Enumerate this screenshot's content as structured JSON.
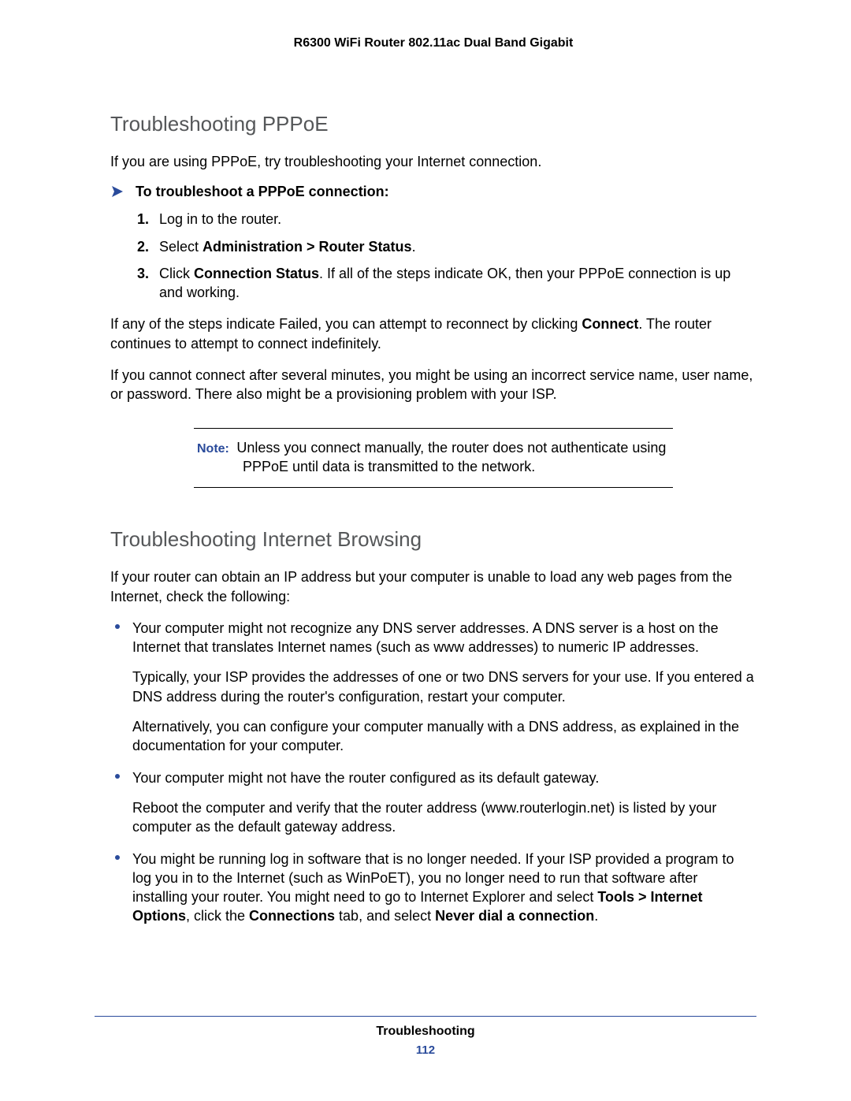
{
  "header": "R6300 WiFi Router 802.11ac Dual Band Gigabit",
  "section1": {
    "title": "Troubleshooting PPPoE",
    "intro": "If you are using PPPoE, try troubleshooting your Internet connection.",
    "proc_label": "To troubleshoot a PPPoE connection:",
    "step1": "Log in to the router.",
    "step2_pre": "Select ",
    "step2_bold": "Administration > Router Status",
    "step2_post": ".",
    "step3_pre": "Click ",
    "step3_bold": "Connection Status",
    "step3_post": ". If all of the steps indicate OK, then your PPPoE connection is up and working.",
    "para2_pre": "If any of the steps indicate Failed, you can attempt to reconnect by clicking ",
    "para2_bold": "Connect",
    "para2_post": ". The router continues to attempt to connect indefinitely.",
    "para3": "If you cannot connect after several minutes, you might be using an incorrect service name, user name, or password. There also might be a provisioning problem with your ISP.",
    "note_label": "Note:",
    "note_line1": "Unless you connect manually, the router does not authenticate using",
    "note_line2": "PPPoE until data is transmitted to the network."
  },
  "section2": {
    "title": "Troubleshooting Internet Browsing",
    "intro": "If your router can obtain an IP address but your computer is unable to load any web pages from the Internet, check the following:",
    "b1_p1": "Your computer might not recognize any DNS server addresses. A DNS server is a host on the Internet that translates Internet names (such as www addresses) to numeric IP addresses.",
    "b1_p2": "Typically, your ISP provides the addresses of one or two DNS servers for your use. If you entered a DNS address during the router's configuration, restart your computer.",
    "b1_p3": "Alternatively, you can configure your computer manually with a DNS address, as explained in the documentation for your computer.",
    "b2_p1": "Your computer might not have the router configured as its default gateway.",
    "b2_p2": "Reboot the computer and verify that the router address (www.routerlogin.net) is listed by your computer as the default gateway address.",
    "b3_p1_pre": "You might be running log in software that is no longer needed. If your ISP provided a program to log you in to the Internet (such as WinPoET), you no longer need to run that software after installing your router. You might need to go to Internet Explorer and select ",
    "b3_bold1": "Tools > Internet Options",
    "b3_mid1": ", click the ",
    "b3_bold2": "Connections",
    "b3_mid2": " tab, and select ",
    "b3_bold3": "Never dial a connection",
    "b3_post": "."
  },
  "footer": {
    "title": "Troubleshooting",
    "page": "112"
  }
}
